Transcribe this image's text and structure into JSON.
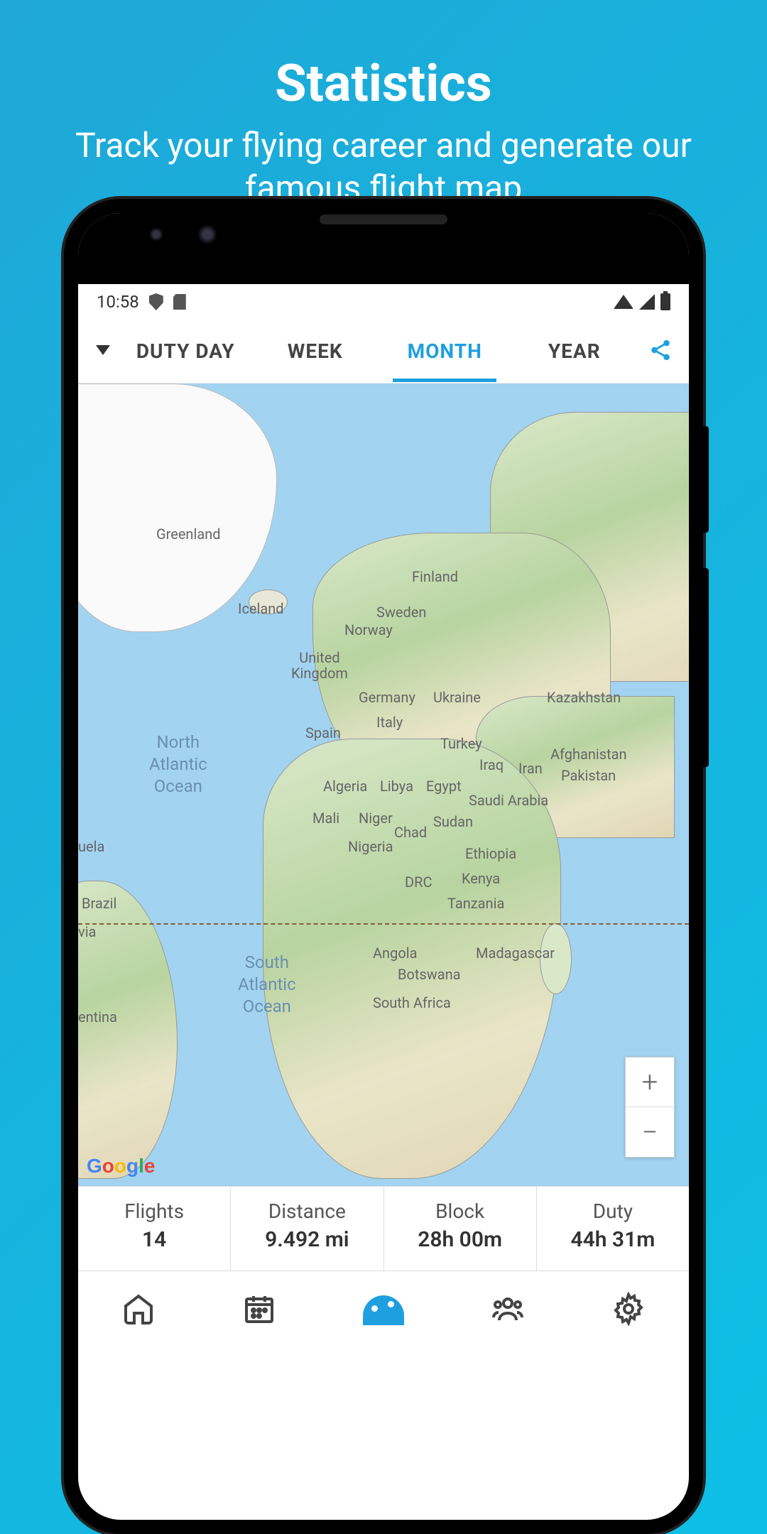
{
  "promo": {
    "title": "Statistics",
    "subtitle": "Track your flying career and generate our famous flight map"
  },
  "statusbar": {
    "time": "10:58"
  },
  "tabs": {
    "items": [
      "DUTY DAY",
      "WEEK",
      "MONTH",
      "YEAR"
    ],
    "active_index": 2
  },
  "map": {
    "attribution": "Google",
    "zoom_in": "+",
    "zoom_out": "−",
    "ocean_labels": {
      "north_atlantic": "North\nAtlantic\nOcean",
      "south_atlantic": "South\nAtlantic\nOcean"
    },
    "country_labels": [
      "Greenland",
      "Iceland",
      "Finland",
      "Sweden",
      "Norway",
      "United Kingdom",
      "Germany",
      "Ukraine",
      "Spain",
      "Italy",
      "Turkey",
      "Kazakhstan",
      "Iraq",
      "Iran",
      "Afghanistan",
      "Pakistan",
      "Algeria",
      "Libya",
      "Egypt",
      "Saudi Arabia",
      "Mali",
      "Niger",
      "Chad",
      "Sudan",
      "Nigeria",
      "Ethiopia",
      "DRC",
      "Kenya",
      "Tanzania",
      "Angola",
      "Botswana",
      "Madagascar",
      "South Africa",
      "Brazil",
      "uela",
      "via",
      "entina"
    ]
  },
  "stats": [
    {
      "label": "Flights",
      "value": "14"
    },
    {
      "label": "Distance",
      "value": "9.492 mi"
    },
    {
      "label": "Block",
      "value": "28h 00m"
    },
    {
      "label": "Duty",
      "value": "44h 31m"
    }
  ]
}
